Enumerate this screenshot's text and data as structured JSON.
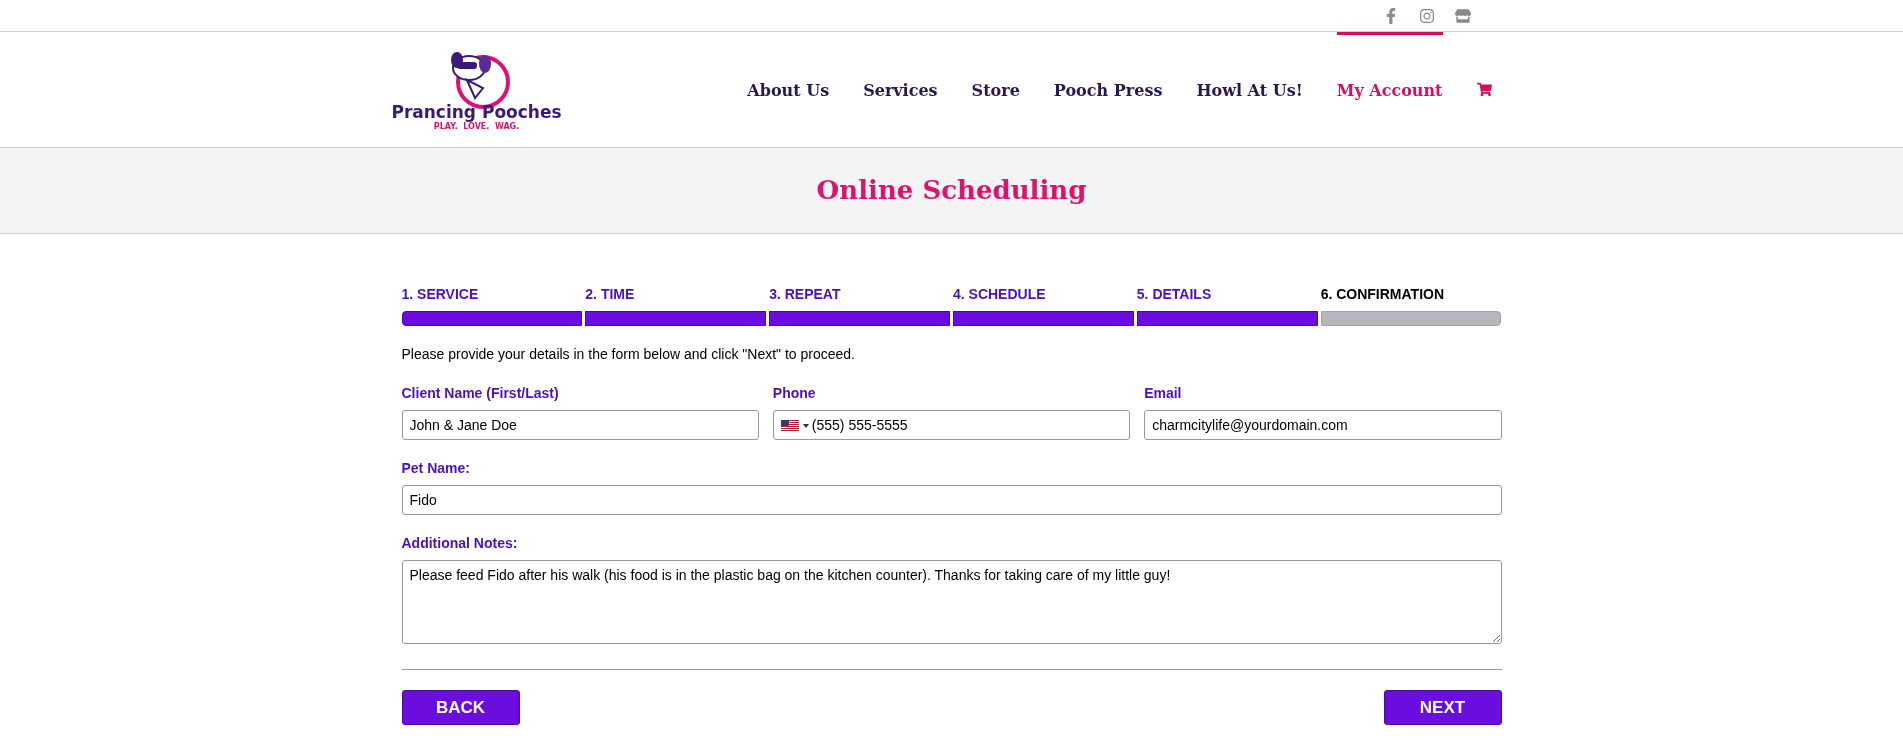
{
  "social_links": [
    {
      "kind": "facebook"
    },
    {
      "kind": "instagram"
    },
    {
      "kind": "store"
    }
  ],
  "logo": {
    "name": "Prancing Pooches",
    "tagline": "PLAY.  LOVE.  WAG."
  },
  "nav": [
    {
      "label": "About Us",
      "selected": false
    },
    {
      "label": "Services",
      "selected": false
    },
    {
      "label": "Store",
      "selected": false
    },
    {
      "label": "Pooch Press",
      "selected": false
    },
    {
      "label": "Howl At Us!",
      "selected": false
    },
    {
      "label": "My Account",
      "selected": true
    }
  ],
  "page_title": "Online Scheduling",
  "steps": [
    {
      "label": "1. SERVICE",
      "completed": true
    },
    {
      "label": "2. TIME",
      "completed": true
    },
    {
      "label": "3. REPEAT",
      "completed": true
    },
    {
      "label": "4. SCHEDULE",
      "completed": true
    },
    {
      "label": "5. DETAILS",
      "completed": true
    },
    {
      "label": "6. CONFIRMATION",
      "completed": false
    }
  ],
  "instruction": "Please provide your details in the form below and click \"Next\" to proceed.",
  "fields": [
    {
      "label": "Client Name (First/Last)",
      "value": "John & Jane Doe",
      "kind": "text"
    },
    {
      "label": "Phone",
      "value": "(555) 555-5555",
      "kind": "phone"
    },
    {
      "label": "Email",
      "value": "charmcitylife@yourdomain.com",
      "kind": "text"
    }
  ],
  "pet_name": {
    "label": "Pet Name:",
    "value": "Fido"
  },
  "notes": {
    "label": "Additional Notes:",
    "value": "Please feed Fido after his walk (his food is in the plastic bag on the kitchen counter). Thanks for taking care of my little guy!"
  },
  "buttons": {
    "back": "BACK",
    "next": "NEXT"
  }
}
